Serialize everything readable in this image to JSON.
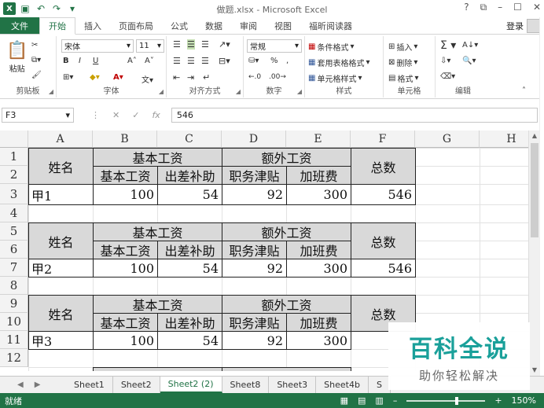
{
  "titlebar": {
    "title": "做题.xlsx - Microsoft Excel",
    "controls": [
      "?",
      "⧉",
      "–",
      "☐",
      "✕"
    ]
  },
  "tabs": {
    "file": "文件",
    "items": [
      "开始",
      "插入",
      "页面布局",
      "公式",
      "数据",
      "审阅",
      "视图",
      "福昕阅读器"
    ],
    "active": "开始",
    "login": "登录"
  },
  "ribbon": {
    "clipboard": {
      "label": "剪贴板",
      "paste": "粘贴"
    },
    "font": {
      "label": "字体",
      "name": "宋体",
      "size": "11",
      "bold": "B",
      "italic": "I",
      "underline": "U"
    },
    "alignment": {
      "label": "对齐方式"
    },
    "number": {
      "label": "数字",
      "format": "常规",
      "percent": "%",
      "comma": ","
    },
    "styles": {
      "label": "样式",
      "conditional": "条件格式",
      "table": "套用表格格式",
      "cell": "单元格样式"
    },
    "cells": {
      "label": "单元格",
      "insert": "插入",
      "delete": "删除",
      "format": "格式"
    },
    "editing": {
      "label": "编辑"
    }
  },
  "formula_bar": {
    "name_box": "F3",
    "content": "546"
  },
  "columns": [
    "A",
    "B",
    "C",
    "D",
    "E",
    "F",
    "G",
    "H"
  ],
  "rows": [
    "1",
    "2",
    "3",
    "4",
    "5",
    "6",
    "7",
    "8",
    "9",
    "10",
    "11",
    "12"
  ],
  "table": {
    "name_header": "姓名",
    "basic_wage": "基本工资",
    "extra_wage": "额外工资",
    "total": "总数",
    "sub_basic": "基本工资",
    "sub_travel": "出差补助",
    "sub_allowance": "职务津贴",
    "sub_overtime": "加班费"
  },
  "records": [
    {
      "name": "甲1",
      "basic": "100",
      "travel": "54",
      "allowance": "92",
      "overtime": "300",
      "total": "546"
    },
    {
      "name": "甲2",
      "basic": "100",
      "travel": "54",
      "allowance": "92",
      "overtime": "300",
      "total": "546"
    },
    {
      "name": "甲3",
      "basic": "100",
      "travel": "54",
      "allowance": "92",
      "overtime": "300",
      "total": ""
    }
  ],
  "sheet_tabs": [
    "Sheet1",
    "Sheet2",
    "Sheet2 (2)",
    "Sheet8",
    "Sheet3",
    "Sheet4b",
    "S"
  ],
  "active_sheet": "Sheet2 (2)",
  "status": {
    "mode": "就绪",
    "zoom": "150%"
  },
  "watermark": {
    "title": "百科全说",
    "subtitle": "助你轻松解决"
  },
  "colors": {
    "excel_green": "#217346",
    "header_gray": "#d9d9d9",
    "watermark": "#1aa09a"
  }
}
